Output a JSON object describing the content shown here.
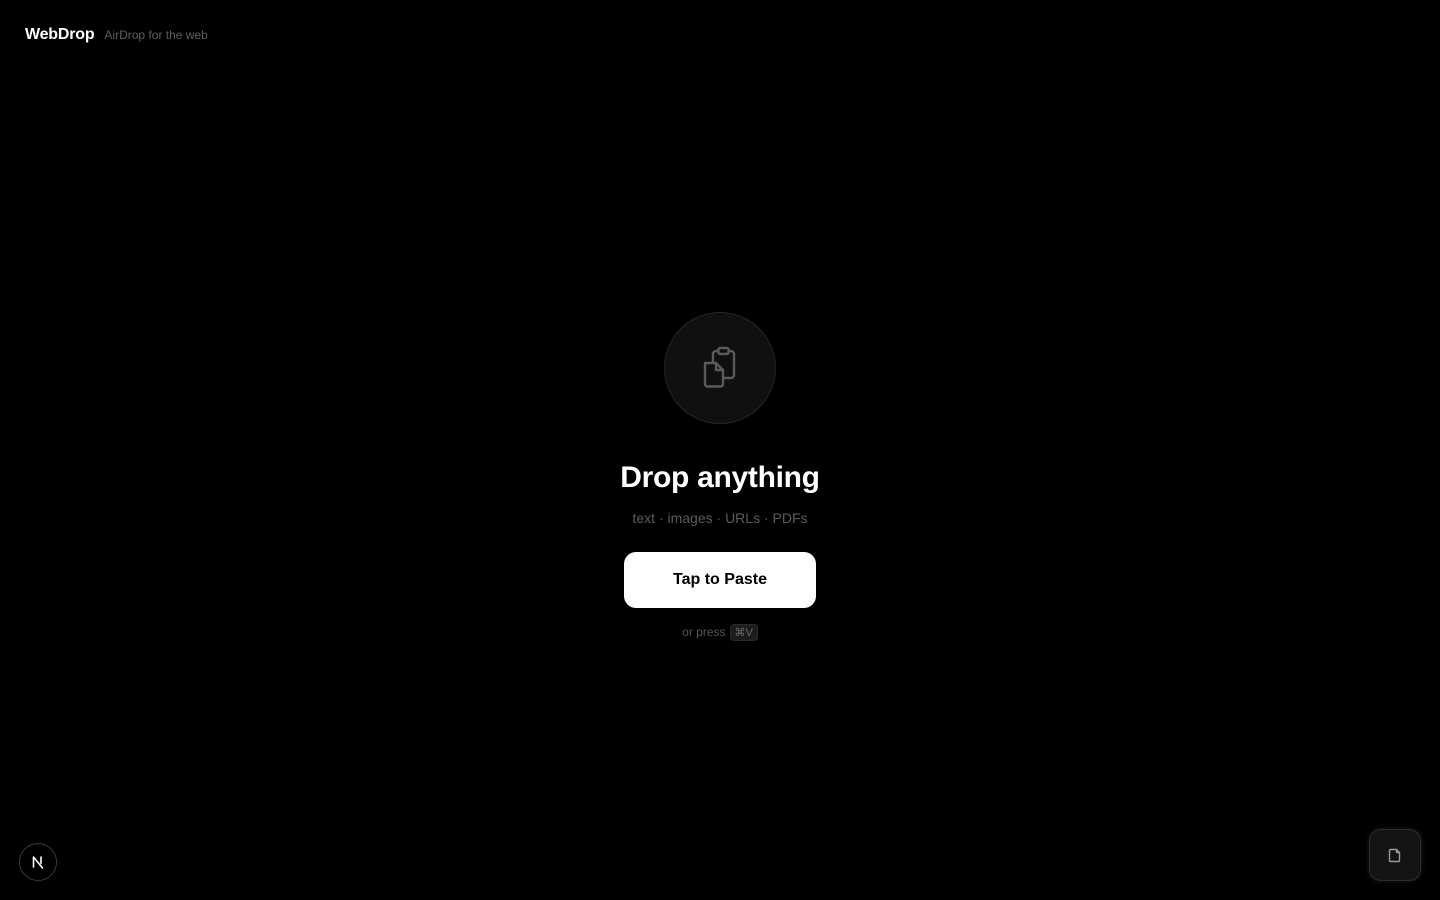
{
  "header": {
    "brand_name": "WebDrop",
    "tagline": "AirDrop for the web"
  },
  "main": {
    "icon": "clipboard-copy-icon",
    "headline": "Drop anything",
    "types_text": "text · images · URLs · PDFs",
    "paste_button_label": "Tap to Paste",
    "hint_prefix": "or press",
    "shortcut_key": "⌘V"
  },
  "footer": {
    "left_badge_icon": "n-logo-icon",
    "right_button_icon": "file-icon"
  },
  "colors": {
    "background": "#000000",
    "primary_text": "#ffffff",
    "muted_text": "#5c5c5c",
    "button_background": "#ffffff",
    "button_text": "#000000"
  }
}
